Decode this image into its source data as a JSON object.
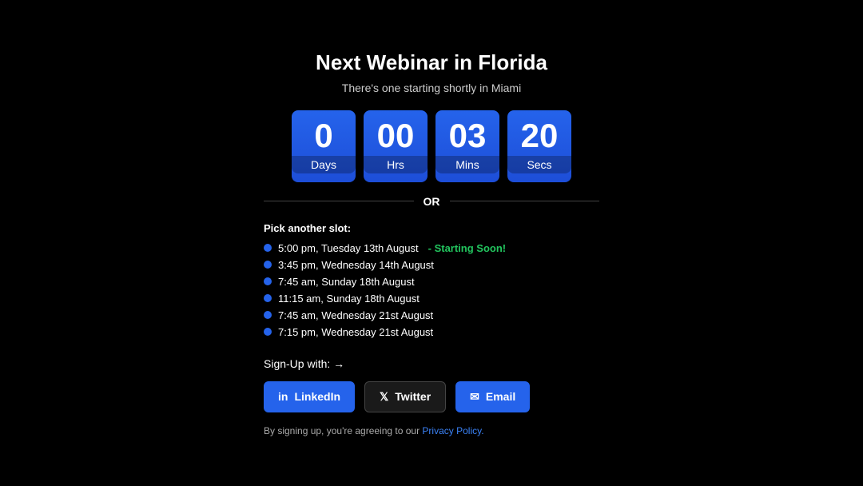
{
  "page": {
    "title": "Next Webinar in Florida",
    "subtitle": "There's one starting shortly in Miami"
  },
  "countdown": {
    "days": {
      "value": "0",
      "label": "Days"
    },
    "hrs": {
      "value": "00",
      "label": "Hrs"
    },
    "mins": {
      "value": "03",
      "label": "Mins"
    },
    "secs": {
      "value": "20",
      "label": "Secs"
    }
  },
  "or_text": "OR",
  "pick_slot_label": "Pick another slot:",
  "slots": [
    {
      "time": "5:00 pm, Tuesday 13th August",
      "status": "Starting Soon!",
      "is_starting_soon": true
    },
    {
      "time": "3:45 pm, Wednesday 14th August",
      "status": "",
      "is_starting_soon": false
    },
    {
      "time": "7:45 am, Sunday 18th August",
      "status": "",
      "is_starting_soon": false
    },
    {
      "time": "11:15 am, Sunday 18th August",
      "status": "",
      "is_starting_soon": false
    },
    {
      "time": "7:45 am, Wednesday 21st August",
      "status": "",
      "is_starting_soon": false
    },
    {
      "time": "7:15 pm, Wednesday 21st August",
      "status": "",
      "is_starting_soon": false
    }
  ],
  "signup_label": "Sign-Up with: →",
  "buttons": {
    "linkedin": "LinkedIn",
    "twitter": "Twitter",
    "email": "Email"
  },
  "privacy": {
    "text": "By signing up, you're agreeing to our ",
    "link_text": "Privacy Policy.",
    "link_url": "#"
  }
}
